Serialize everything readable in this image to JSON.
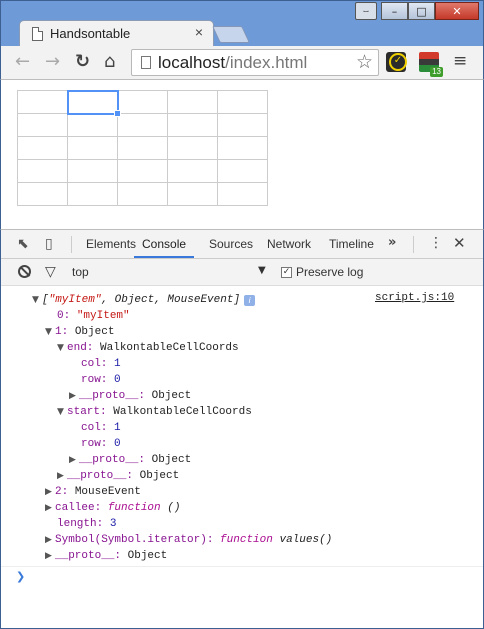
{
  "window": {
    "tab_title": "Handsontable",
    "tab_close": "×",
    "buttons": {
      "user": "⧿",
      "minimize": "–",
      "maximize": "□",
      "close": "✕"
    }
  },
  "toolbar": {
    "back": "←",
    "forward": "→",
    "reload": "↻",
    "home": "⌂",
    "url_host": "localhost",
    "url_path": "/index.html",
    "star": "☆",
    "ext2_badge": "13",
    "menu": "≡"
  },
  "grid": {
    "rows": 5,
    "cols": 5,
    "selected": {
      "row": 0,
      "col": 1
    }
  },
  "devtools": {
    "tabs": [
      "Elements",
      "Console",
      "Sources",
      "Network",
      "Timeline"
    ],
    "active_tab": "Console",
    "more": "»",
    "kebab": "⋮",
    "close": "✕",
    "inspect_icon": "⬉",
    "device_icon": "▯",
    "filter_icon": "▽",
    "context": "top",
    "context_caret": "▼",
    "preserve_log_label": "Preserve log",
    "preserve_log_checked": true,
    "checkmark": "✓"
  },
  "console": {
    "source_link": "script.js:10",
    "prompt": "❯",
    "log": {
      "open": "[",
      "item_string": "\"myItem\"",
      "rest": ", Object, MouseEvent",
      "close": "]",
      "badge": "i"
    },
    "lines": {
      "idx0_key": "0:",
      "idx0_val": "\"myItem\"",
      "idx1_key": "1:",
      "idx1_val": "Object",
      "end_key": "end:",
      "end_val": "WalkontableCellCoords",
      "end_col_key": "col:",
      "end_col_val": "1",
      "end_row_key": "row:",
      "end_row_val": "0",
      "end_proto_key": "__proto__:",
      "end_proto_val": "Object",
      "start_key": "start:",
      "start_val": "WalkontableCellCoords",
      "start_col_key": "col:",
      "start_col_val": "1",
      "start_row_key": "row:",
      "start_row_val": "0",
      "start_proto_key": "__proto__:",
      "start_proto_val": "Object",
      "obj_proto_key": "__proto__:",
      "obj_proto_val": "Object",
      "idx2_key": "2:",
      "idx2_val": "MouseEvent",
      "callee_key": "callee:",
      "callee_fn": "function",
      "callee_sig": "()",
      "length_key": "length:",
      "length_val": "3",
      "iter_key": "Symbol(Symbol.iterator):",
      "iter_fn": "function",
      "iter_sig": "values()",
      "arr_proto_key": "__proto__:",
      "arr_proto_val": "Object"
    },
    "arrows": {
      "expanded": "▼",
      "collapsed": "▶"
    }
  }
}
